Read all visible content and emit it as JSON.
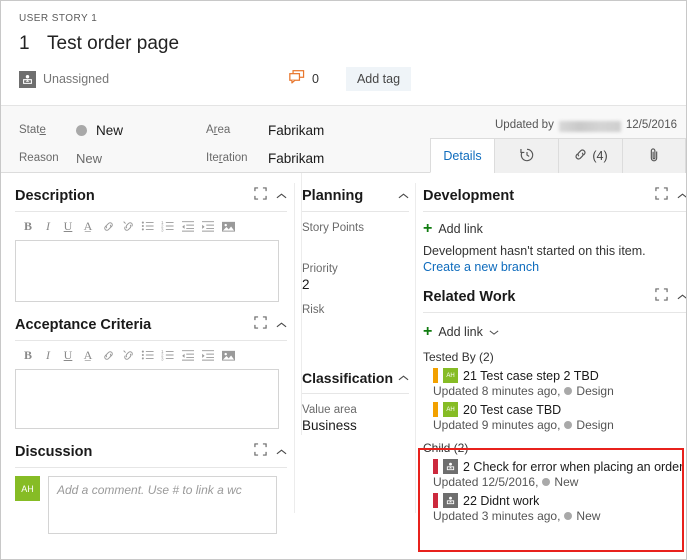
{
  "header": {
    "breadcrumb": "USER STORY 1",
    "work_item_id": "1",
    "title": "Test order page",
    "assigned_to": "Unassigned",
    "assigned_icon": "person-square-icon",
    "comment_icon": "comment-bubbles-icon",
    "comment_count": "0",
    "add_tag_label": "Add tag",
    "accent_color": "#0a90c8"
  },
  "fields": {
    "state_label": "State",
    "state_value": "New",
    "state_dot_color": "#a9a9a9",
    "reason_label": "Reason",
    "reason_value": "New",
    "area_label": "Area",
    "area_value": "Fabrikam",
    "iteration_label": "Iteration",
    "iteration_value": "Fabrikam",
    "updated_by_label": "Updated by",
    "updated_by_name": "",
    "updated_date": "12/5/2016"
  },
  "tabs": [
    {
      "label": "Details",
      "icon": "",
      "count": "",
      "active": true
    },
    {
      "label": "",
      "icon": "history-clock-icon",
      "count": "",
      "active": false
    },
    {
      "label": "",
      "icon": "link-icon",
      "count": "(4)",
      "active": false
    },
    {
      "label": "",
      "icon": "paperclip-icon",
      "count": "",
      "active": false
    }
  ],
  "description": {
    "title": "Description",
    "expand_icon": "expand-icon",
    "collapse_icon": "chevron-up-icon",
    "value": ""
  },
  "acceptance": {
    "title": "Acceptance Criteria",
    "expand_icon": "expand-icon",
    "collapse_icon": "chevron-up-icon",
    "value": ""
  },
  "discussion": {
    "title": "Discussion",
    "expand_icon": "expand-icon",
    "collapse_icon": "chevron-up-icon",
    "avatar_initials": "AH",
    "avatar_color": "#86bc25",
    "placeholder": "Add a comment. Use # to link a wc"
  },
  "rte_buttons": [
    {
      "name": "bold-icon",
      "glyph": "B"
    },
    {
      "name": "italic-icon",
      "glyph": "I"
    },
    {
      "name": "underline-icon",
      "glyph": "U"
    },
    {
      "name": "clear-format-icon",
      "glyph": "A"
    },
    {
      "name": "insert-link-icon",
      "glyph": "⎘"
    },
    {
      "name": "remove-link-icon",
      "glyph": "⎘"
    },
    {
      "name": "bullet-list-icon",
      "glyph": "≡"
    },
    {
      "name": "numbered-list-icon",
      "glyph": "≡"
    },
    {
      "name": "outdent-icon",
      "glyph": "⇤"
    },
    {
      "name": "indent-icon",
      "glyph": "⇥"
    },
    {
      "name": "insert-image-icon",
      "glyph": "▣"
    }
  ],
  "planning": {
    "title": "Planning",
    "collapse_icon": "chevron-up-icon",
    "rows": [
      {
        "label": "Story Points",
        "value": ""
      },
      {
        "label": "Priority",
        "value": "2"
      },
      {
        "label": "Risk",
        "value": ""
      }
    ]
  },
  "classification": {
    "title": "Classification",
    "collapse_icon": "chevron-up-icon",
    "rows": [
      {
        "label": "Value area",
        "value": "Business"
      }
    ]
  },
  "development": {
    "title": "Development",
    "expand_icon": "expand-icon",
    "collapse_icon": "chevron-up-icon",
    "add_link_label": "Add link",
    "note": "Development hasn't started on this item.",
    "branch_link": "Create a new branch"
  },
  "related_work": {
    "title": "Related Work",
    "expand_icon": "expand-icon",
    "collapse_icon": "chevron-up-icon",
    "add_link_label": "Add link",
    "add_link_caret": "˅",
    "groups": [
      {
        "name": "tested-by",
        "heading": "Tested By (2)",
        "items": [
          {
            "bar_color": "#f2a100",
            "avatar_initials": "AH",
            "avatar_kind": "green",
            "id": "21",
            "title": "21 Test case step 2 TBD",
            "updated": "Updated 8 minutes ago,",
            "state": "Design"
          },
          {
            "bar_color": "#f2a100",
            "avatar_initials": "AH",
            "avatar_kind": "green",
            "id": "20",
            "title": "20 Test case TBD",
            "updated": "Updated 9 minutes ago,",
            "state": "Design"
          }
        ]
      },
      {
        "name": "child",
        "heading": "Child (2)",
        "highlighted": true,
        "highlight_color": "#e8211c",
        "items": [
          {
            "bar_color": "#cc293d",
            "avatar_initials": "",
            "avatar_kind": "grey",
            "id": "2",
            "title": "2 Check for error when placing an order",
            "updated": "Updated 12/5/2016,",
            "state": "New"
          },
          {
            "bar_color": "#cc293d",
            "avatar_initials": "",
            "avatar_kind": "grey",
            "id": "22",
            "title": "22 Didnt work",
            "updated": "Updated 3 minutes ago,",
            "state": "New"
          }
        ]
      }
    ]
  }
}
